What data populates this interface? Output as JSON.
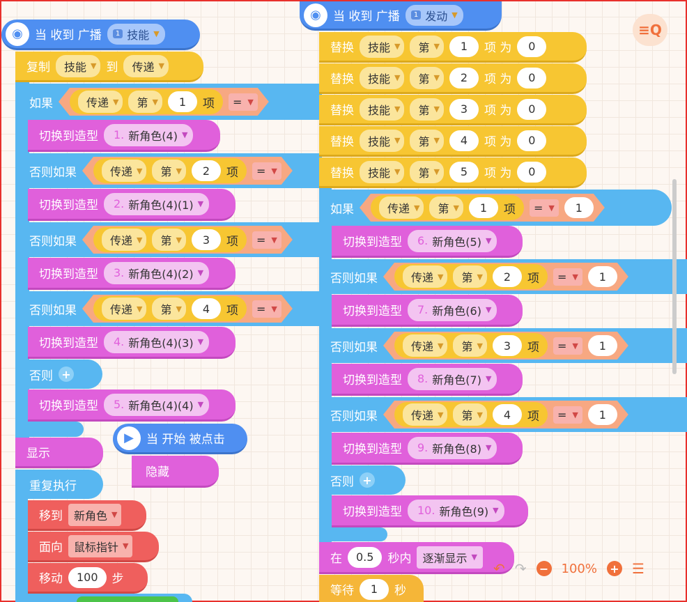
{
  "left": {
    "event": {
      "label_a": "当 收到 广播",
      "message": "技能",
      "tag": "1"
    },
    "copy": {
      "label": "复制",
      "src": "技能",
      "to": "到",
      "dst": "传递"
    },
    "if_label": "如果",
    "elseif_label": "否则如果",
    "else_label": "否则",
    "cond": {
      "list": "传递",
      "nth": "第",
      "item": "项",
      "op": "="
    },
    "switch_label": "切换到造型",
    "branches": [
      {
        "idx": "1",
        "costume_num": "1.",
        "costume": "新角色(4)"
      },
      {
        "idx": "2",
        "costume_num": "2.",
        "costume": "新角色(4)(1)"
      },
      {
        "idx": "3",
        "costume_num": "3.",
        "costume": "新角色(4)(2)"
      },
      {
        "idx": "4",
        "costume_num": "4.",
        "costume": "新角色(4)(3)"
      }
    ],
    "else_costume": {
      "costume_num": "5.",
      "costume": "新角色(4)(4)"
    },
    "show": "显示",
    "repeat": "重复执行",
    "move_to": {
      "label": "移到",
      "target": "新角色"
    },
    "face": {
      "label": "面向",
      "target": "鼠标指针"
    },
    "move": {
      "label": "移动",
      "value": "100",
      "unit": "步"
    }
  },
  "start": {
    "label": "当 开始 被点击",
    "hide": "隐藏"
  },
  "right": {
    "event": {
      "label_a": "当 收到 广播",
      "message": "发动",
      "tag": "1"
    },
    "replace": {
      "label": "替换",
      "list": "技能",
      "nth": "第",
      "item": "项 为",
      "values": [
        "1",
        "2",
        "3",
        "4",
        "5"
      ],
      "to": "0"
    },
    "if_label": "如果",
    "elseif_label": "否则如果",
    "else_label": "否则",
    "cond": {
      "list": "传递",
      "nth": "第",
      "item": "项",
      "op": "=",
      "rhs": "1"
    },
    "switch_label": "切换到造型",
    "branches": [
      {
        "idx": "1",
        "costume_num": "6.",
        "costume": "新角色(5)"
      },
      {
        "idx": "2",
        "costume_num": "7.",
        "costume": "新角色(6)"
      },
      {
        "idx": "3",
        "costume_num": "8.",
        "costume": "新角色(7)"
      },
      {
        "idx": "4",
        "costume_num": "9.",
        "costume": "新角色(8)"
      }
    ],
    "else_costume": {
      "costume_num": "10.",
      "costume": "新角色(9)"
    },
    "fade": {
      "label": "在",
      "secs": "0.5",
      "within": "秒内",
      "effect": "逐渐显示"
    },
    "wait": {
      "label": "等待",
      "secs": "1",
      "unit": "秒"
    }
  },
  "zoom": {
    "value": "100%"
  }
}
